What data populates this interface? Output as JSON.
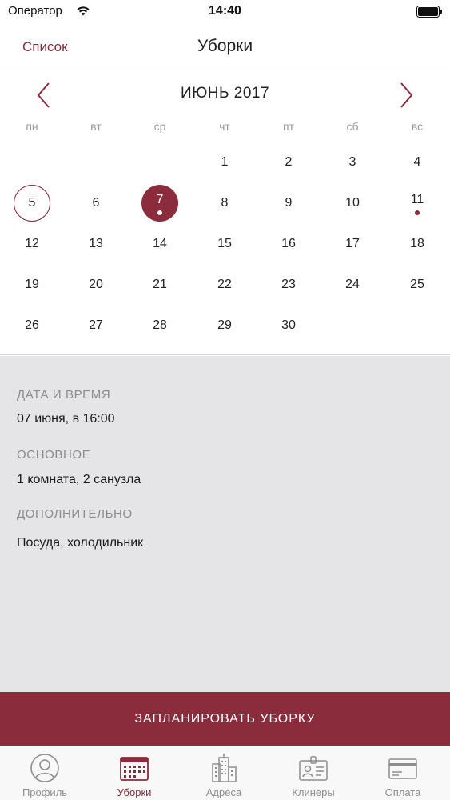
{
  "status_bar": {
    "carrier": "Оператор",
    "time": "14:40"
  },
  "nav": {
    "back_label": "Список",
    "title": "Уборки"
  },
  "calendar": {
    "month_label": "ИЮНЬ 2017",
    "weekdays": [
      "пн",
      "вт",
      "ср",
      "чт",
      "пт",
      "сб",
      "вс"
    ],
    "weeks": [
      [
        "",
        "",
        "",
        "1",
        "2",
        "3",
        "4"
      ],
      [
        "5",
        "6",
        "7",
        "8",
        "9",
        "10",
        "11"
      ],
      [
        "12",
        "13",
        "14",
        "15",
        "16",
        "17",
        "18"
      ],
      [
        "19",
        "20",
        "21",
        "22",
        "23",
        "24",
        "25"
      ],
      [
        "26",
        "27",
        "28",
        "29",
        "30",
        "",
        ""
      ]
    ],
    "today": "5",
    "selected": "7",
    "marked_days": [
      "7",
      "11"
    ]
  },
  "details": {
    "datetime_label": "ДАТА И ВРЕМЯ",
    "datetime_value": "07 июня, в 16:00",
    "main_label": "ОСНОВНОЕ",
    "main_value": "1 комната, 2 санузла",
    "extra_label": "ДОПОЛНИТЕЛЬНО",
    "extra_value": "Посуда, холодильник"
  },
  "cta_label": "ЗАПЛАНИРОВАТЬ УБОРКУ",
  "tabs": [
    {
      "label": "Профиль",
      "icon": "profile-icon",
      "active": false
    },
    {
      "label": "Уборки",
      "icon": "calendar-icon",
      "active": true
    },
    {
      "label": "Адреса",
      "icon": "buildings-icon",
      "active": false
    },
    {
      "label": "Клинеры",
      "icon": "badge-icon",
      "active": false
    },
    {
      "label": "Оплата",
      "icon": "card-icon",
      "active": false
    }
  ],
  "colors": {
    "accent": "#8b2c3d",
    "details_bg": "#e5e4e6",
    "tab_inactive": "#8e8e8e"
  }
}
